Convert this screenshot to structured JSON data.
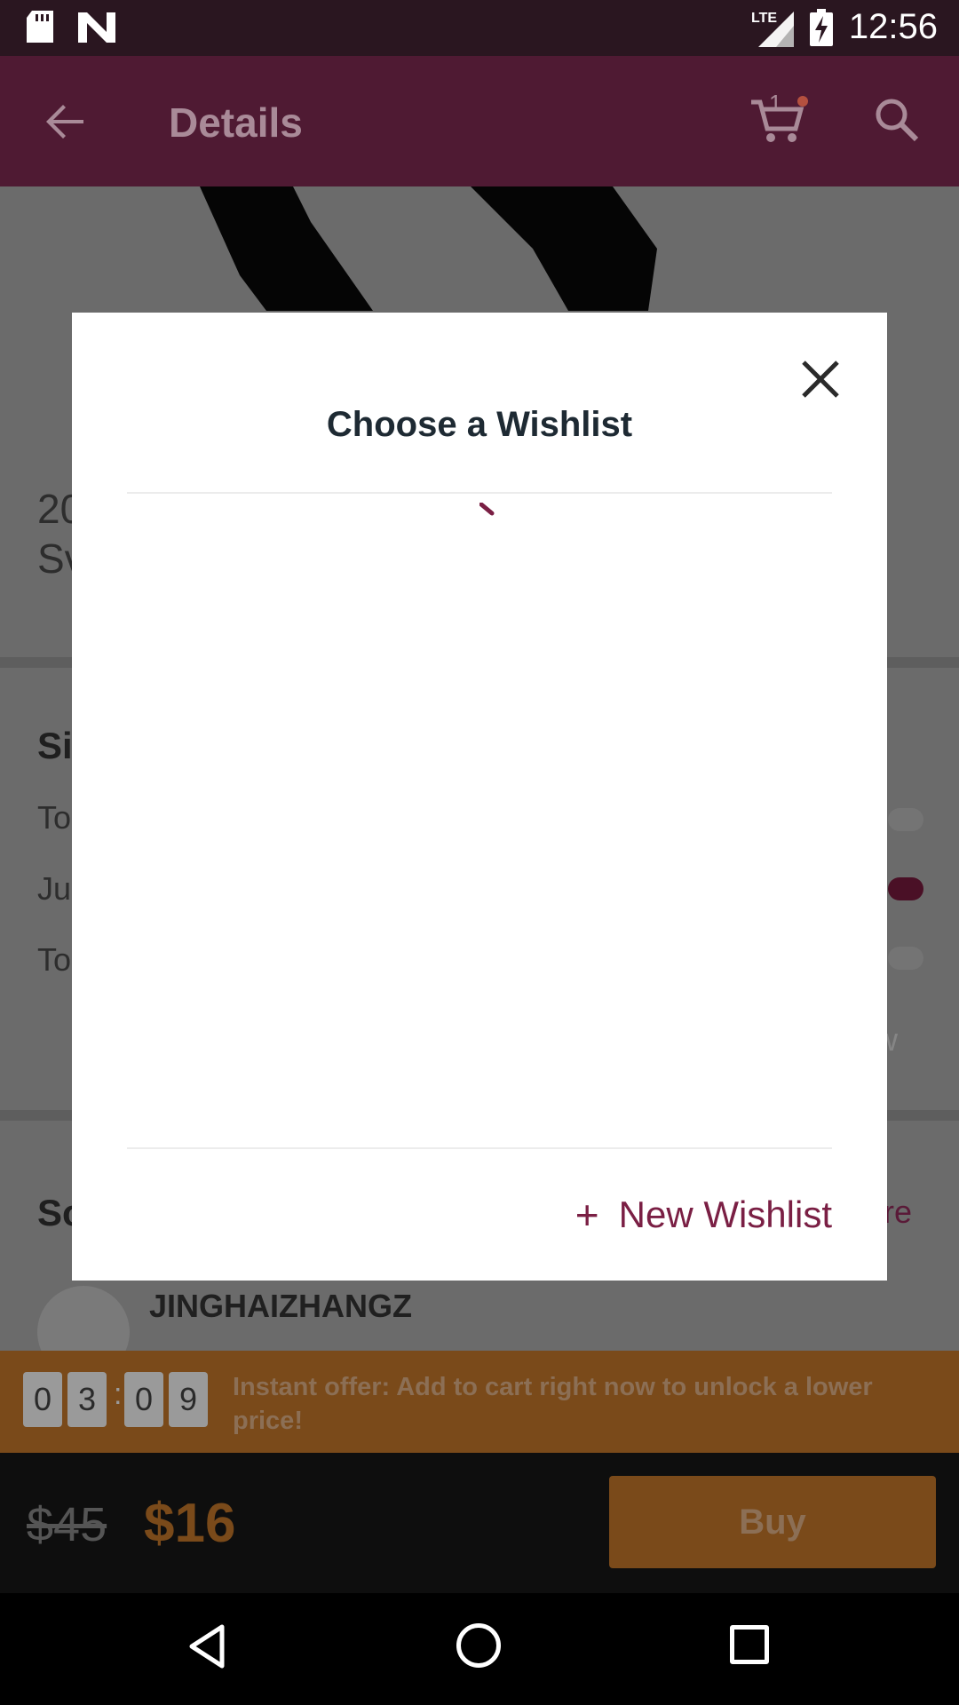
{
  "status_bar": {
    "time": "12:56",
    "network": "LTE",
    "icons": [
      "sd-card-icon",
      "n-icon",
      "signal-icon",
      "battery-charging-icon"
    ]
  },
  "app_bar": {
    "title": "Details",
    "cart_count": "1",
    "icons": [
      "back-arrow-icon",
      "cart-icon",
      "search-icon"
    ]
  },
  "background": {
    "product_title_line1": "20",
    "product_title_line2": "Sv",
    "size_heading": "Si",
    "rows": [
      "To",
      "Ju",
      "To"
    ],
    "view_text": "ew",
    "seller_section_heading": "So",
    "more_text": "ore",
    "seller_name": "JINGHAIZHANGZ"
  },
  "offer": {
    "timer_digits": [
      "0",
      "3",
      "0",
      "9"
    ],
    "separator": ":",
    "text": "Instant offer: Add to cart right now to unlock a lower price!"
  },
  "buy_bar": {
    "old_price": "$45",
    "new_price": "$16",
    "buy_label": "Buy"
  },
  "modal": {
    "title": "Choose a Wishlist",
    "new_wishlist_plus": "+",
    "new_wishlist_label": "New Wishlist",
    "loading": true
  },
  "colors": {
    "accent": "#7a1f44",
    "appbar": "#4f1a33",
    "offer": "#7a4a1a",
    "modal_title": "#1e2a33"
  }
}
